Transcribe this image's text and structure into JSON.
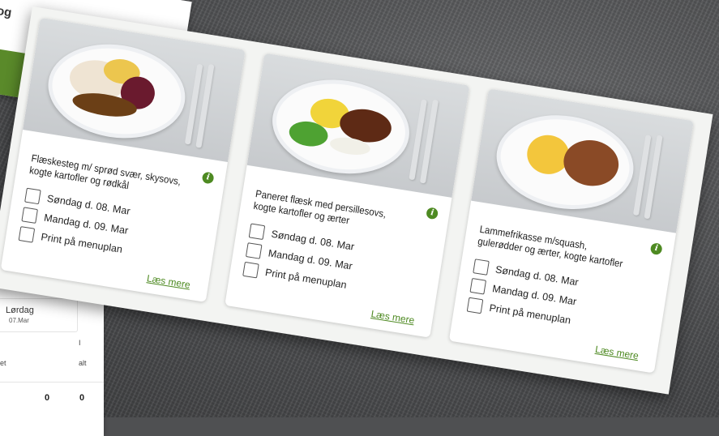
{
  "top_page": {
    "title": "log"
  },
  "bottom_page": {
    "day": "Lørdag",
    "date": "07.Mar",
    "header_i": "I",
    "header_left": "let",
    "header_alt": "alt",
    "value1": "0",
    "value2": "0"
  },
  "cards": [
    {
      "title": "Flæskesteg m/ sprød svær, skysovs, kogte kartofler og rødkål",
      "options": [
        "Søndag d. 08. Mar",
        "Mandag d. 09. Mar",
        "Print på menuplan"
      ],
      "read_more": "Læs mere",
      "info_icon": "info-icon"
    },
    {
      "title": "Paneret flæsk med persillesovs, kogte kartofler og ærter",
      "options": [
        "Søndag d. 08. Mar",
        "Mandag d. 09. Mar",
        "Print på menuplan"
      ],
      "read_more": "Læs mere",
      "info_icon": "info-icon"
    },
    {
      "title": "Lammefrikasse m/squash, gulerødder og ærter, kogte kartofler",
      "options": [
        "Søndag d. 08. Mar",
        "Mandag d. 09. Mar",
        "Print på menuplan"
      ],
      "read_more": "Læs mere",
      "info_icon": "info-icon"
    }
  ],
  "colors": {
    "accent": "#4e8a22",
    "brand_band": "#5a8a2a",
    "background": "#4f5052"
  }
}
